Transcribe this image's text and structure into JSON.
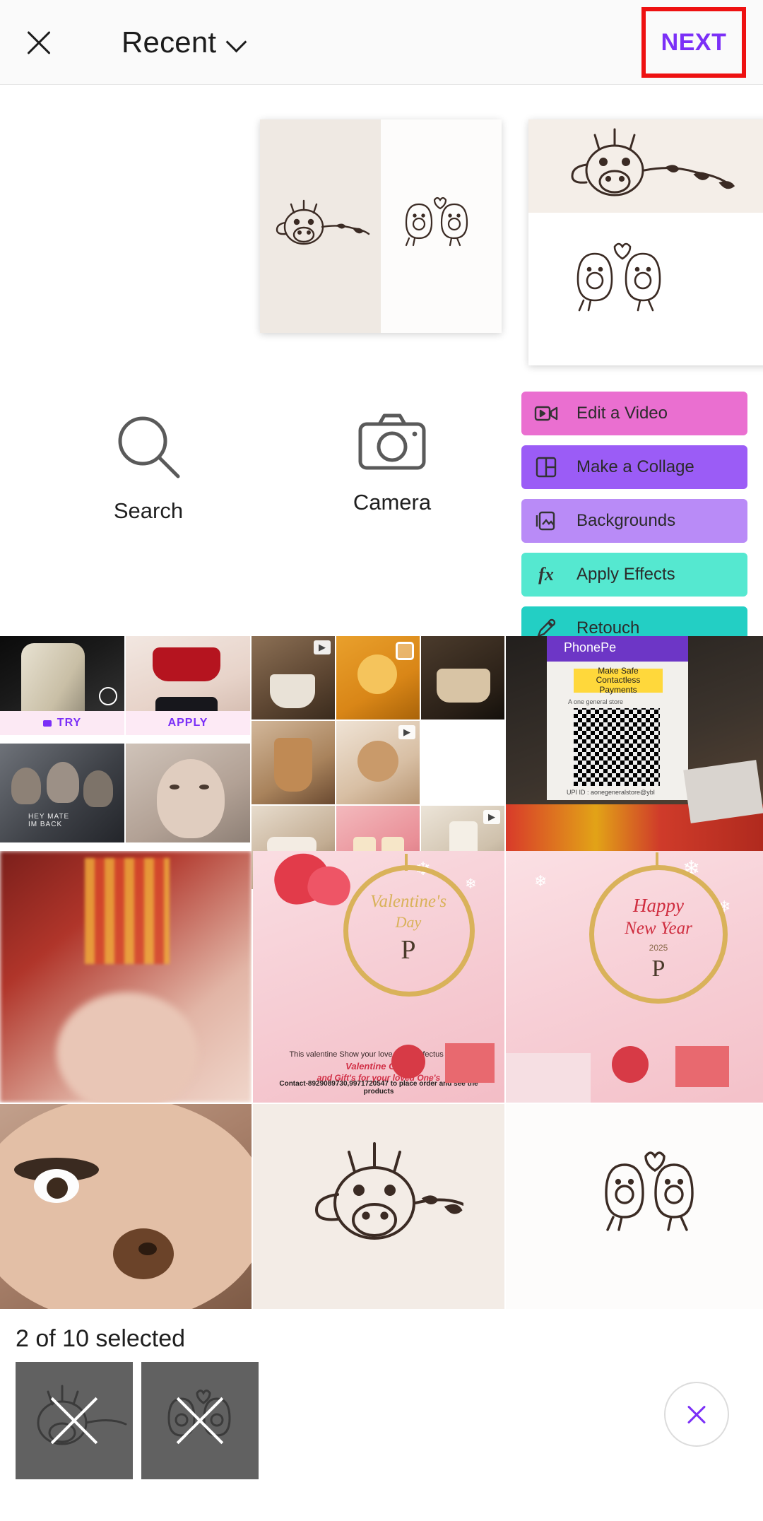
{
  "header": {
    "close_icon": "close-icon",
    "album_label": "Recent",
    "chevron_icon": "chevron-down-icon",
    "next_label": "NEXT",
    "next_color": "#7b2ff7",
    "highlight_color": "#ee1111"
  },
  "preview": {
    "cards": [
      {
        "name": "collage-preview-1",
        "art": [
          "giraffe",
          "avocado-couple"
        ]
      },
      {
        "name": "collage-preview-2",
        "art": [
          "giraffe",
          "avocado-couple"
        ]
      }
    ]
  },
  "actions": {
    "search": {
      "label": "Search",
      "icon": "search-icon"
    },
    "camera": {
      "label": "Camera",
      "icon": "camera-icon"
    },
    "pills": [
      {
        "label": "Edit a Video",
        "icon": "video-icon",
        "color": "#ea6fd0"
      },
      {
        "label": "Make a Collage",
        "icon": "collage-icon",
        "color": "#9b5cf6"
      },
      {
        "label": "Backgrounds",
        "icon": "backgrounds-icon",
        "color": "#b98bf7"
      },
      {
        "label": "Apply Effects",
        "icon": "fx-icon",
        "color": "#55e8d0"
      },
      {
        "label": "Retouch",
        "icon": "retouch-icon",
        "color": "#23cfc4"
      }
    ]
  },
  "gallery": {
    "badges": {
      "try": "TRY",
      "apply": "APPLY"
    },
    "items": [
      {
        "name": "photo-fashion-gold",
        "badge": "try"
      },
      {
        "name": "photo-red-top",
        "badge": "apply"
      },
      {
        "name": "photo-coffee-pour",
        "video": true
      },
      {
        "name": "photo-caramel-spoon",
        "selectable": true
      },
      {
        "name": "photo-cake-dark"
      },
      {
        "name": "photo-qr-poster"
      },
      {
        "name": "photo-group-men"
      },
      {
        "name": "photo-portrait-woman"
      },
      {
        "name": "photo-iced-coffee"
      },
      {
        "name": "photo-latte-art",
        "video": true
      },
      {
        "name": "photo-cups-table"
      },
      {
        "name": "photo-dessert-pink"
      },
      {
        "name": "photo-milkshake",
        "video": true
      },
      {
        "name": "photo-blur-orange"
      },
      {
        "name": "photo-valentines-card"
      },
      {
        "name": "photo-newyear-card"
      },
      {
        "name": "photo-face-filter"
      },
      {
        "name": "photo-giraffe-doodle"
      },
      {
        "name": "photo-avocado-doodle"
      }
    ],
    "valentines_card": {
      "title_line1": "Valentine's",
      "title_line2": "Day",
      "monogram": "P",
      "sub1": "This valentine Show your love with Perfectus Gifting",
      "sub2": "Valentine Gift's",
      "sub3": "and Gift's for your loved One's",
      "contact": "Contact-8929089730,9971720547 to place order and see the products"
    },
    "newyear_card": {
      "title_line1": "Happy",
      "title_line2": "New Year",
      "year": "2025",
      "monogram": "P"
    }
  },
  "selection": {
    "status": "2 of 10 selected",
    "thumbs": [
      {
        "name": "selected-thumb-giraffe"
      },
      {
        "name": "selected-thumb-avocado"
      }
    ],
    "clear_icon": "close-icon",
    "clear_color": "#7b2ff7"
  }
}
